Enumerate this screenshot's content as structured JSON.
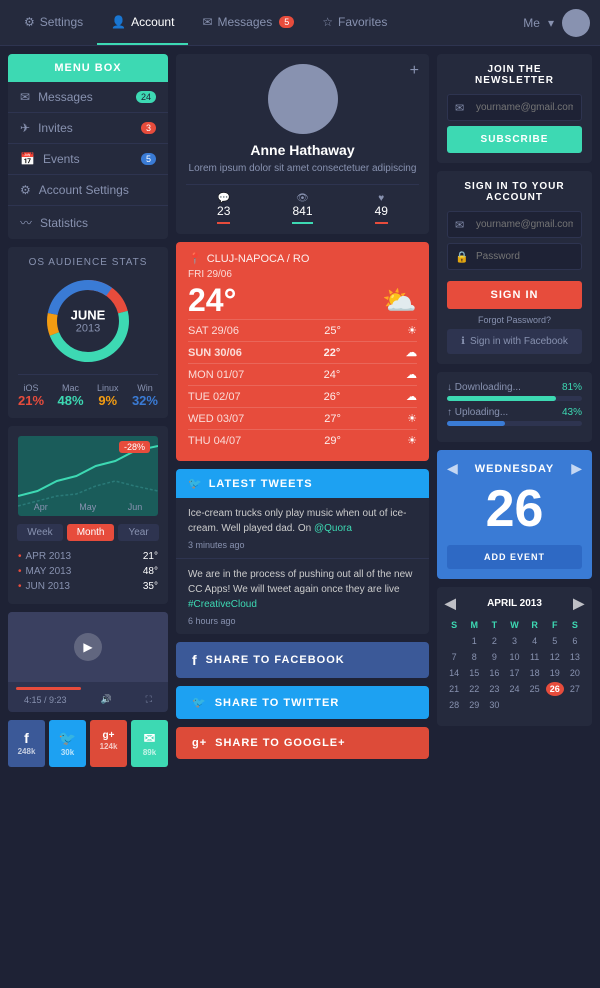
{
  "nav": {
    "items": [
      {
        "label": "Settings",
        "icon": "gear",
        "active": false
      },
      {
        "label": "Account",
        "icon": "user",
        "active": true
      },
      {
        "label": "Messages",
        "icon": "mail",
        "active": false,
        "badge": "5"
      },
      {
        "label": "Favorites",
        "icon": "star",
        "active": false
      }
    ],
    "user": "Me",
    "chevron": "▾"
  },
  "menu": {
    "title": "MENU BOX",
    "items": [
      {
        "label": "Messages",
        "icon": "mail",
        "badge": "24",
        "badgeType": "default"
      },
      {
        "label": "Invites",
        "icon": "paper",
        "badge": "3",
        "badgeType": "red"
      },
      {
        "label": "Events",
        "icon": "calendar",
        "badge": "5",
        "badgeType": "blue"
      },
      {
        "label": "Account Settings",
        "icon": "gear",
        "badge": "",
        "badgeType": ""
      },
      {
        "label": "Statistics",
        "icon": "chart",
        "badge": "",
        "badgeType": ""
      }
    ]
  },
  "audience": {
    "title": "OS AUDIENCE STATS",
    "month": "JUNE",
    "year": "2013",
    "stats": [
      {
        "label": "iOS",
        "value": "21%",
        "class": "ios"
      },
      {
        "label": "Mac",
        "value": "48%",
        "class": "mac"
      },
      {
        "label": "Linux",
        "value": "9%",
        "class": "linux"
      },
      {
        "label": "Win",
        "value": "32%",
        "class": "win"
      }
    ]
  },
  "chart": {
    "badge": "-28%",
    "tabs": [
      "Week",
      "Month",
      "Year"
    ],
    "activeTab": "Month",
    "legend": [
      {
        "label": "APR 2013",
        "value": "21°"
      },
      {
        "label": "MAY 2013",
        "value": "48°"
      },
      {
        "label": "JUN 2013",
        "value": "35°"
      }
    ]
  },
  "video": {
    "time": "4:15",
    "duration": "9:23"
  },
  "social_counts": [
    {
      "icon": "f",
      "label": "fb",
      "count": "248k",
      "class": "fb"
    },
    {
      "icon": "t",
      "label": "tw",
      "count": "30k",
      "class": "tw"
    },
    {
      "icon": "g+",
      "label": "gp",
      "count": "124k",
      "class": "gp"
    },
    {
      "icon": "✉",
      "label": "em",
      "count": "89k",
      "class": "em"
    }
  ],
  "profile": {
    "name": "Anne Hathaway",
    "desc": "Lorem ipsum dolor sit amet consectetuer adipiscing",
    "stats": [
      {
        "icon": "💬",
        "value": "23"
      },
      {
        "icon": "👁",
        "value": "841"
      },
      {
        "icon": "♥",
        "value": "49"
      }
    ]
  },
  "weather": {
    "location": "CLUJ-NAPOCA / RO",
    "date": "FRI 29/06",
    "temp": "24°",
    "icon": "⛅",
    "forecast": [
      {
        "day": "SAT 29/06",
        "temp": "25°",
        "icon": "☀"
      },
      {
        "day": "SUN 30/06",
        "temp": "22°",
        "icon": "☁",
        "highlight": true
      },
      {
        "day": "MON 01/07",
        "temp": "24°",
        "icon": "☁"
      },
      {
        "day": "TUE 02/07",
        "temp": "26°",
        "icon": "☁"
      },
      {
        "day": "WED 03/07",
        "temp": "27°",
        "icon": "☀"
      },
      {
        "day": "THU 04/07",
        "temp": "29°",
        "icon": "☀"
      }
    ]
  },
  "tweets": {
    "header": "LATEST TWEETS",
    "items": [
      {
        "text": "Ice-cream trucks only play music when out of ice-cream. Well played dad. On ",
        "link": "@Quora",
        "time": "3 minutes ago"
      },
      {
        "text": "We are in the process of pushing out all of the new CC Apps! We will tweet again once they are live ",
        "link": "#CreativeCloud",
        "time": "6 hours ago"
      }
    ]
  },
  "share_buttons": [
    {
      "label": "SHARE TO FACEBOOK",
      "icon": "f",
      "class": "share-fb"
    },
    {
      "label": "SHARE TO TWITTER",
      "icon": "🐦",
      "class": "share-tw"
    },
    {
      "label": "SHARE TO GOOGLE+",
      "icon": "g+",
      "class": "share-gp"
    }
  ],
  "newsletter": {
    "title": "JOIN THE NEWSLETTER",
    "placeholder": "yourname@gmail.com",
    "button": "SUBSCRIBE"
  },
  "signin": {
    "title": "SIGN IN TO YOUR ACCOUNT",
    "email_placeholder": "yourname@gmail.com",
    "pass_placeholder": "Password",
    "button": "SIGN IN",
    "forgot": "Forgot Password?",
    "fb_button": "Sign in with Facebook"
  },
  "download": {
    "items": [
      {
        "label": "Downloading...",
        "pct": 81,
        "pctLabel": "81%",
        "color": "cyan"
      },
      {
        "label": "Uploading...",
        "pct": 43,
        "pctLabel": "43%",
        "color": "blue"
      }
    ]
  },
  "big_calendar": {
    "day_name": "WEDNESDAY",
    "day": "26",
    "button": "ADD EVENT"
  },
  "mini_calendar": {
    "month": "APRIL 2013",
    "headers": [
      "S",
      "M",
      "T",
      "W",
      "R",
      "F",
      "S"
    ],
    "rows": [
      [
        "",
        "1",
        "2",
        "3",
        "4",
        "5",
        "6"
      ],
      [
        "7",
        "8",
        "9",
        "10",
        "11",
        "12",
        "13"
      ],
      [
        "14",
        "15",
        "16",
        "17",
        "18",
        "19",
        "20"
      ],
      [
        "21",
        "22",
        "23",
        "24",
        "25",
        "26",
        "27",
        "28",
        "29"
      ],
      [
        "30",
        "",
        "",
        "",
        "",
        "",
        ""
      ]
    ],
    "today": "26"
  }
}
